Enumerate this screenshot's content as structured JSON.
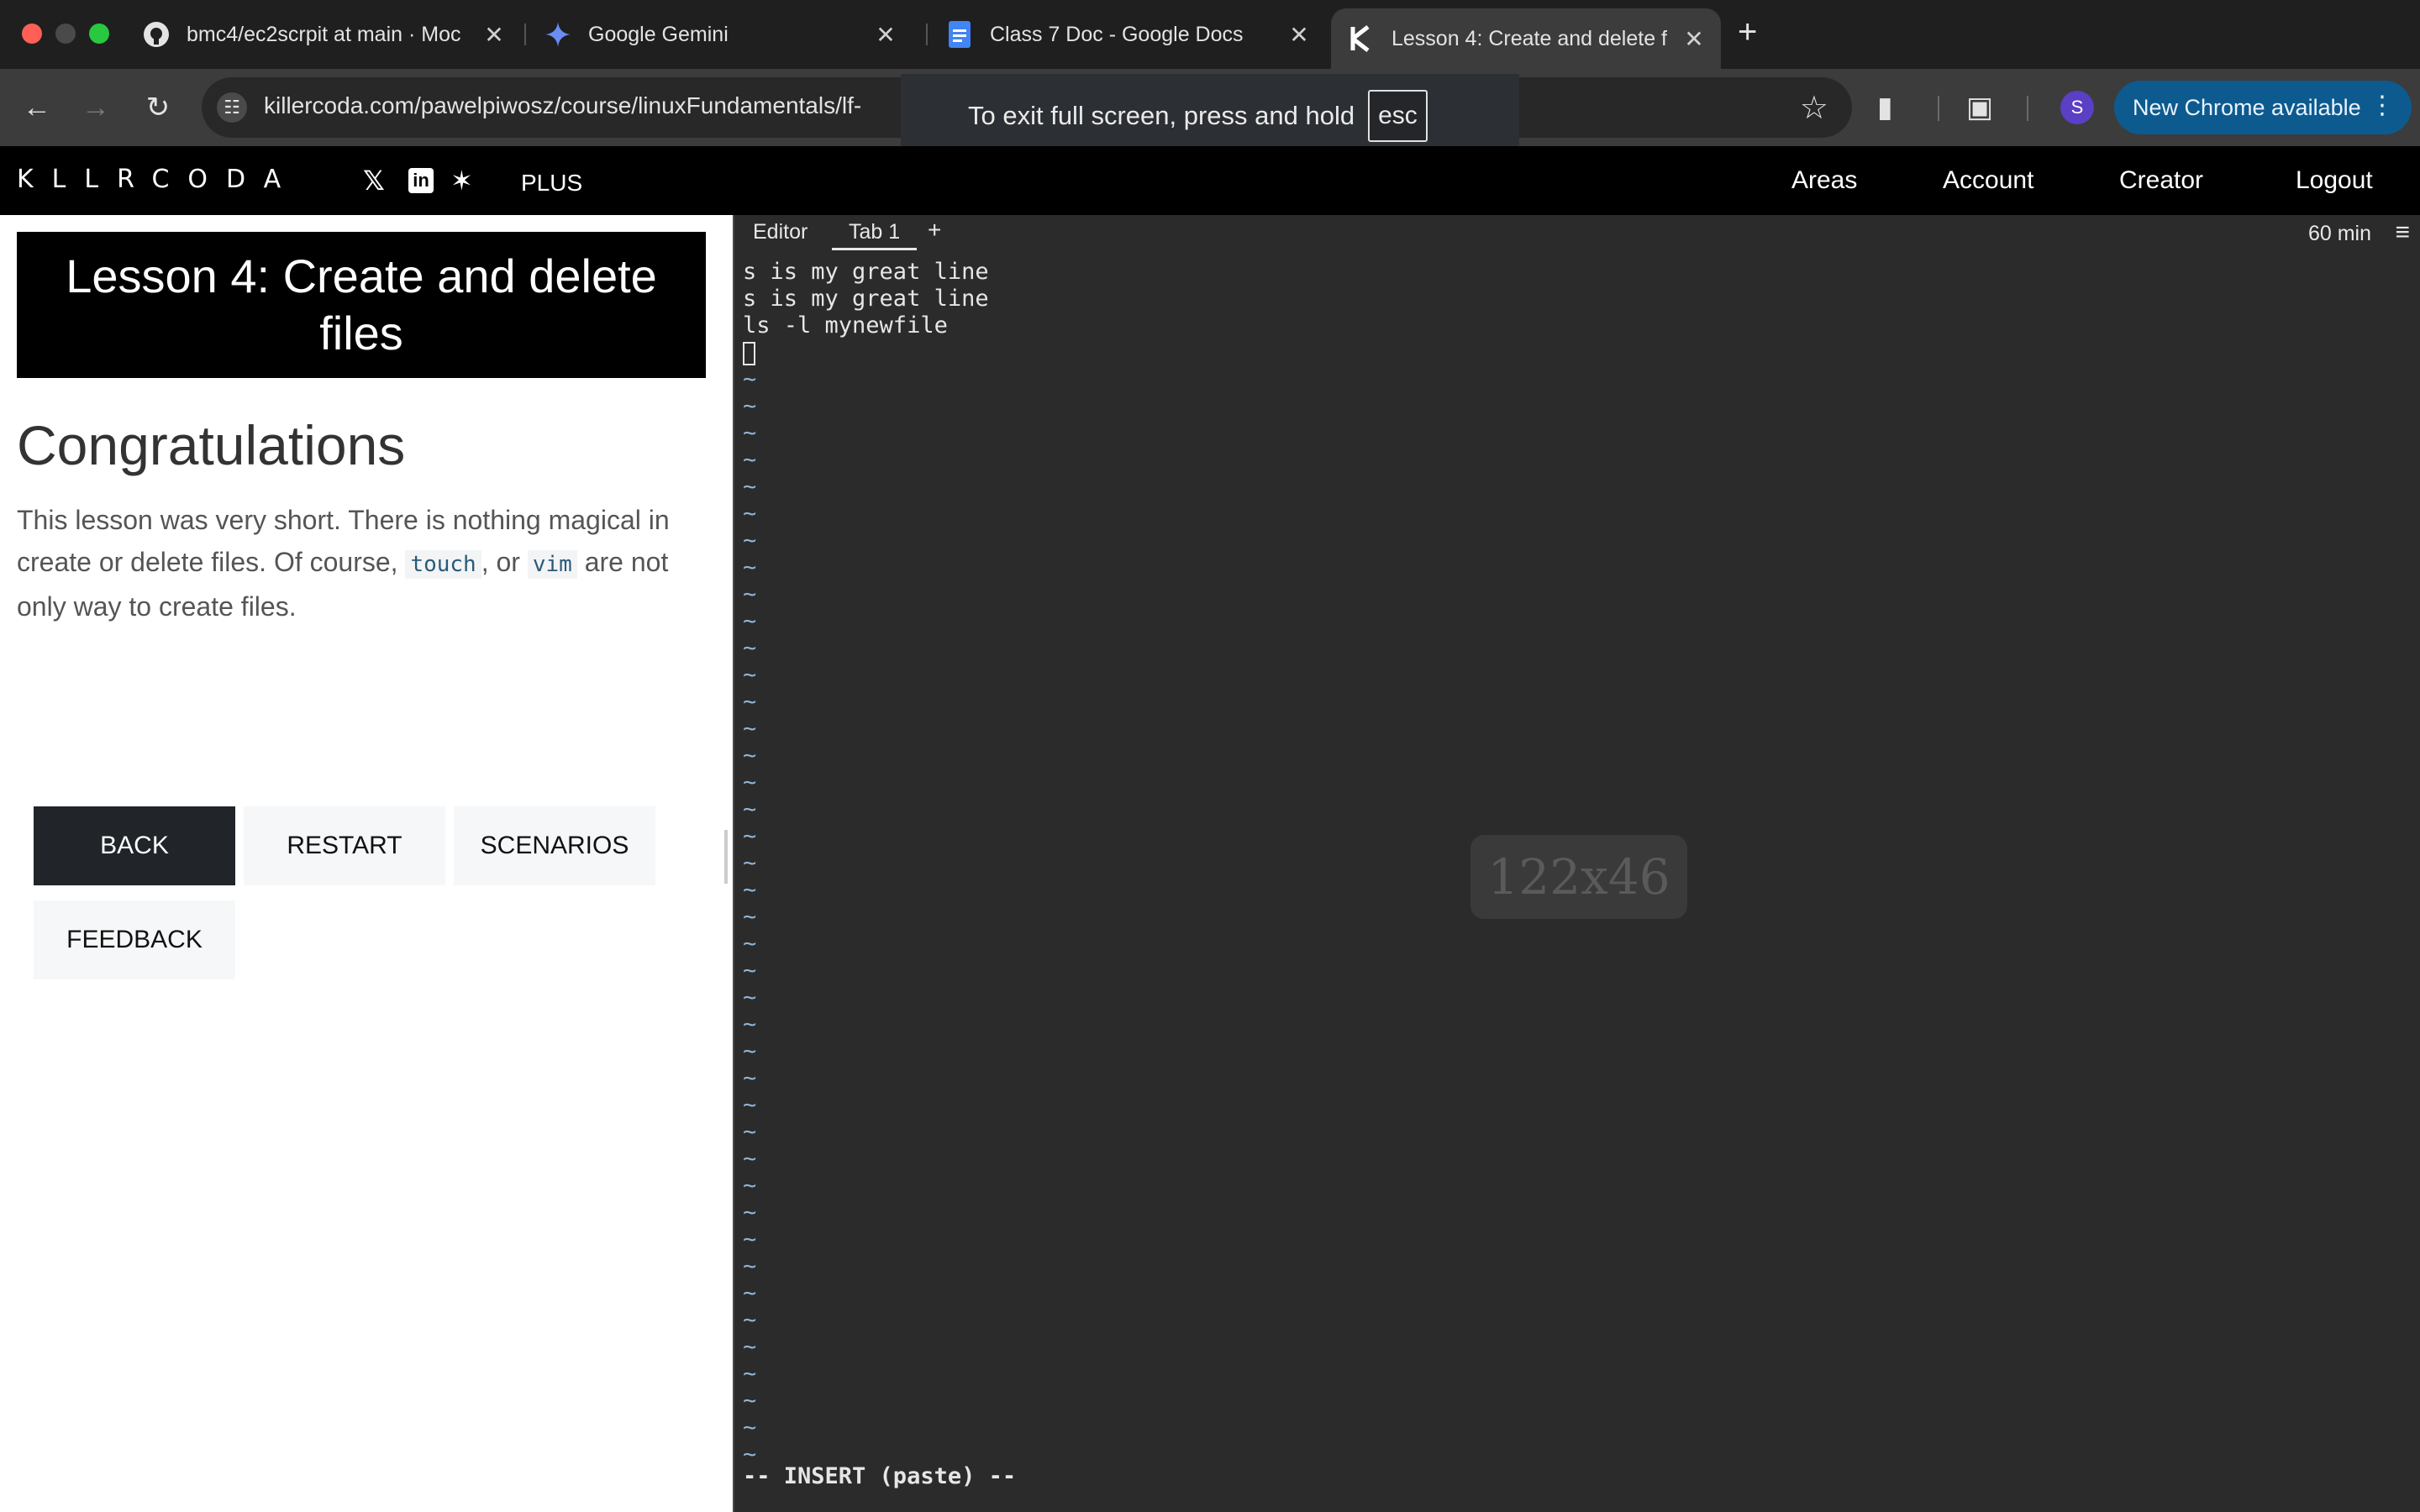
{
  "browser": {
    "tabs": [
      {
        "title": "bmc4/ec2scrpit at main · Moc",
        "icon": "github-icon",
        "close": "✕"
      },
      {
        "title": "Google Gemini",
        "icon": "gemini-icon",
        "close": "✕"
      },
      {
        "title": "Class 7 Doc - Google Docs",
        "icon": "google-docs-icon",
        "close": "✕"
      },
      {
        "title": "Lesson 4: Create and delete f",
        "icon": "killercoda-icon",
        "close": "✕",
        "active": true
      }
    ],
    "new_tab": "+",
    "url": "killercoda.com/pawelpiwosz/course/linuxFundamentals/lf-",
    "profile_initial": "S",
    "update_label": "New Chrome available",
    "fullscreen_toast": {
      "text": "To exit full screen, press and hold",
      "key": "esc"
    }
  },
  "site": {
    "logo": "KLLRCODA",
    "plus": "PLUS",
    "nav": [
      "Areas",
      "Account",
      "Creator",
      "Logout"
    ]
  },
  "lesson": {
    "title": "Lesson 4: Create and delete files",
    "heading": "Congratulations",
    "body_before": "This lesson was very short. There is nothing magical in create or delete files. Of course, ",
    "code1": "touch",
    "body_mid": ", or ",
    "code2": "vim",
    "body_after": " are not only way to create files.",
    "buttons": {
      "back": "BACK",
      "restart": "RESTART",
      "scenarios": "SCENARIOS",
      "feedback": "FEEDBACK"
    }
  },
  "terminal": {
    "tab_editor": "Editor",
    "tab_1": "Tab 1",
    "tab_add": "+",
    "timer": "60 min",
    "lines": [
      "s is my great line",
      "s is my great line",
      "ls -l mynewfile"
    ],
    "tilde": "~",
    "tilde_count": 41,
    "status": "-- INSERT (paste) --",
    "size_overlay": "122x46"
  },
  "colors": {
    "chrome_bg": "#1f1f1f",
    "toolbar_bg": "#3c3c3c",
    "terminal_bg": "#2b2b2b",
    "update_pill": "#0d5a8f",
    "button_dark": "#212529"
  }
}
